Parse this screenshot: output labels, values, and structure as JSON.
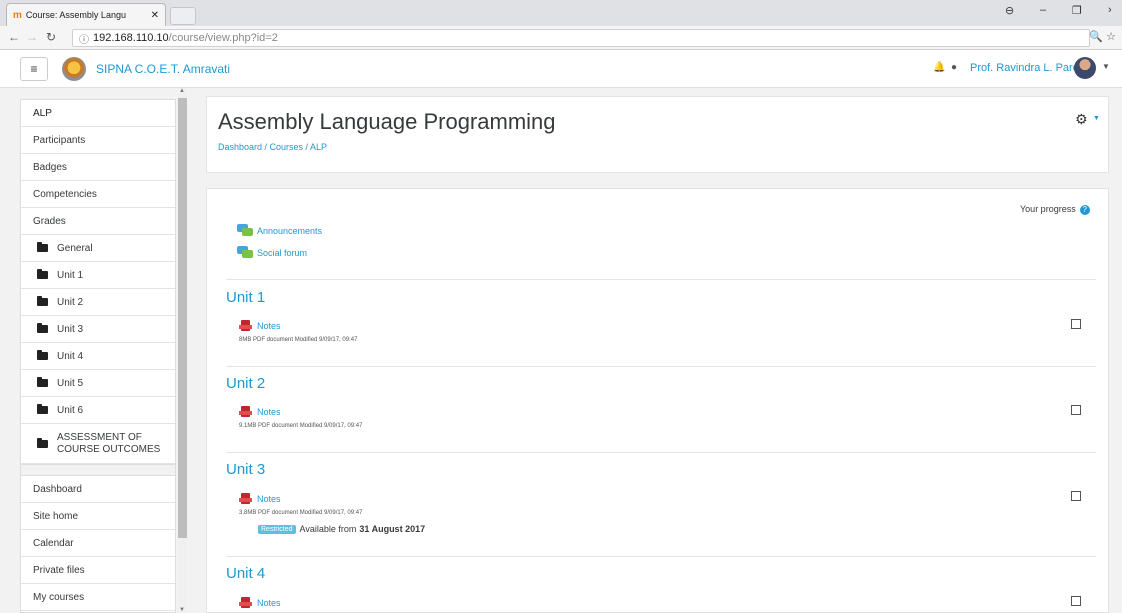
{
  "browser": {
    "tab_title": "Course: Assembly Langu",
    "url_host": "192.168.110.10",
    "url_path": "/course/view.php?id=2",
    "account_icon": "⊖",
    "min_icon": "–",
    "max_icon": "❐",
    "more_icon": "›"
  },
  "navbar": {
    "site_name": "SIPNA C.O.E.T. Amravati",
    "user_name": "Prof. Ravindra L. Pardhi"
  },
  "sidebar": {
    "course_items": [
      {
        "label": "ALP",
        "type": "header"
      },
      {
        "label": "Participants",
        "type": "link"
      },
      {
        "label": "Badges",
        "type": "link"
      },
      {
        "label": "Competencies",
        "type": "link"
      },
      {
        "label": "Grades",
        "type": "link"
      },
      {
        "label": "General",
        "type": "folder"
      },
      {
        "label": "Unit 1",
        "type": "folder"
      },
      {
        "label": "Unit 2",
        "type": "folder"
      },
      {
        "label": "Unit 3",
        "type": "folder"
      },
      {
        "label": "Unit 4",
        "type": "folder"
      },
      {
        "label": "Unit 5",
        "type": "folder"
      },
      {
        "label": "Unit 6",
        "type": "folder"
      },
      {
        "label": "ASSESSMENT OF COURSE OUTCOMES",
        "type": "folder-tall"
      }
    ],
    "site_items": [
      "Dashboard",
      "Site home",
      "Calendar",
      "Private files",
      "My courses"
    ]
  },
  "header": {
    "page_title": "Assembly Language Programming",
    "breadcrumb": "Dashboard / Courses / ALP"
  },
  "content": {
    "progress_label": "Your progress",
    "forums": [
      "Announcements",
      "Social forum"
    ],
    "sections": [
      {
        "title": "Unit 1",
        "resource": "Notes",
        "meta": "8MB PDF document Modified 9/09/17, 09:47"
      },
      {
        "title": "Unit 2",
        "resource": "Notes",
        "meta": "9.1MB PDF document Modified 9/09/17, 09:47"
      },
      {
        "title": "Unit 3",
        "resource": "Notes",
        "meta": "3.8MB PDF document Modified 9/09/17, 09:47",
        "restriction_badge": "Restricted",
        "restriction_text": "Available from",
        "restriction_date": "31 August 2017"
      },
      {
        "title": "Unit 4",
        "resource": "Notes"
      }
    ]
  }
}
